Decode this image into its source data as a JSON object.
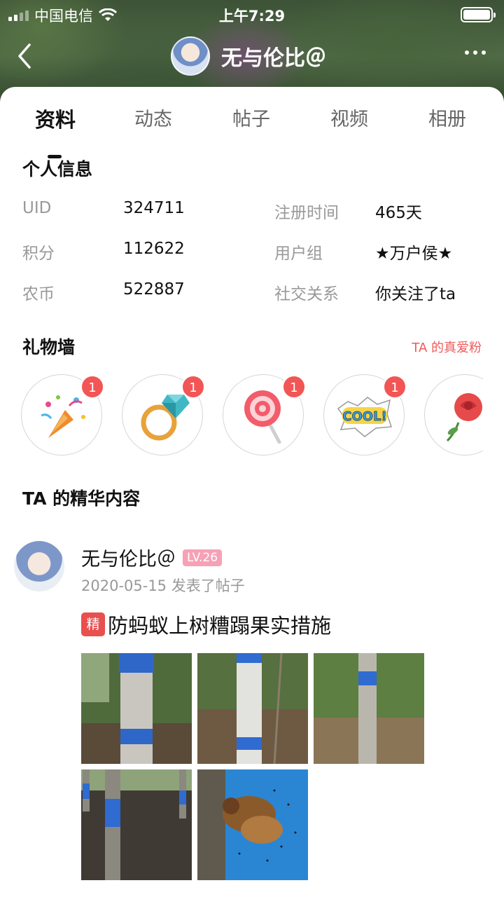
{
  "status": {
    "carrier": "中国电信",
    "time": "上午7:29"
  },
  "nav": {
    "username": "无与伦比＠"
  },
  "tabs": [
    "资料",
    "动态",
    "帖子",
    "视频",
    "相册"
  ],
  "profile": {
    "section_title": "个人信息",
    "rows": [
      {
        "k1": "UID",
        "v1": "324711",
        "k2": "注册时间",
        "v2": "465天"
      },
      {
        "k1": "积分",
        "v1": "112622",
        "k2": "用户组",
        "v2": "★万户侯★"
      },
      {
        "k1": "农币",
        "v1": "522887",
        "k2": "社交关系",
        "v2": "你关注了ta"
      }
    ]
  },
  "gift_wall": {
    "title": "礼物墙",
    "link": "TA 的真爱粉",
    "gifts": [
      {
        "icon": "party-popper-icon",
        "count": "1"
      },
      {
        "icon": "diamond-ring-icon",
        "count": "1"
      },
      {
        "icon": "lollipop-icon",
        "count": "1"
      },
      {
        "icon": "cool-sticker-icon",
        "count": "1"
      },
      {
        "icon": "rose-icon",
        "count": ""
      }
    ]
  },
  "featured": {
    "title": "TA 的精华内容",
    "post": {
      "author": "无与伦比＠",
      "level": "LV.26",
      "meta": "2020-05-15 发表了帖子",
      "tag": "精",
      "title": "防蚂蚁上树糟蹋果实措施"
    }
  }
}
